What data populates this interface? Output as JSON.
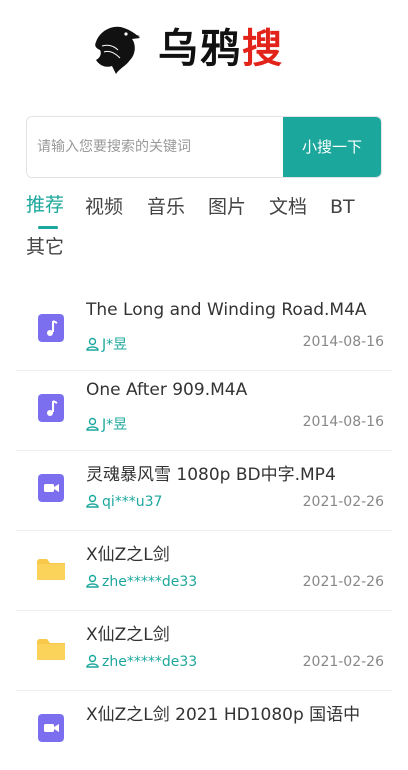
{
  "logo": {
    "text_black": "乌鸦",
    "text_red": "搜"
  },
  "search": {
    "placeholder": "请输入您要搜索的关键词",
    "button_label": "小搜一下"
  },
  "tabs": [
    "推荐",
    "视频",
    "音乐",
    "图片",
    "文档",
    "BT",
    "其它"
  ],
  "active_tab": "推荐",
  "results": [
    {
      "icon": "music-file-icon",
      "name": "The Long and Winding Road.M4A",
      "user": "J*昱",
      "date": "2014-08-16"
    },
    {
      "icon": "music-file-icon",
      "name": "One After 909.M4A",
      "user": "J*昱",
      "date": "2014-08-16"
    },
    {
      "icon": "video-file-icon",
      "name": "灵魂暴风雪 1080p BD中字.MP4",
      "user": "qi***u37",
      "date": "2021-02-26"
    },
    {
      "icon": "folder-icon",
      "name": "X仙Z之L剑",
      "user": "zhe*****de33",
      "date": "2021-02-26"
    },
    {
      "icon": "folder-icon",
      "name": "X仙Z之L剑",
      "user": "zhe*****de33",
      "date": "2021-02-26"
    },
    {
      "icon": "video-file-icon",
      "name": "X仙Z之L剑 2021 HD1080p 国语中",
      "user": "",
      "date": ""
    }
  ],
  "colors": {
    "accent": "#1ca79d",
    "logo_red": "#e2231a",
    "file_icon": "#7b6ff0",
    "folder": "#f8c84a"
  }
}
